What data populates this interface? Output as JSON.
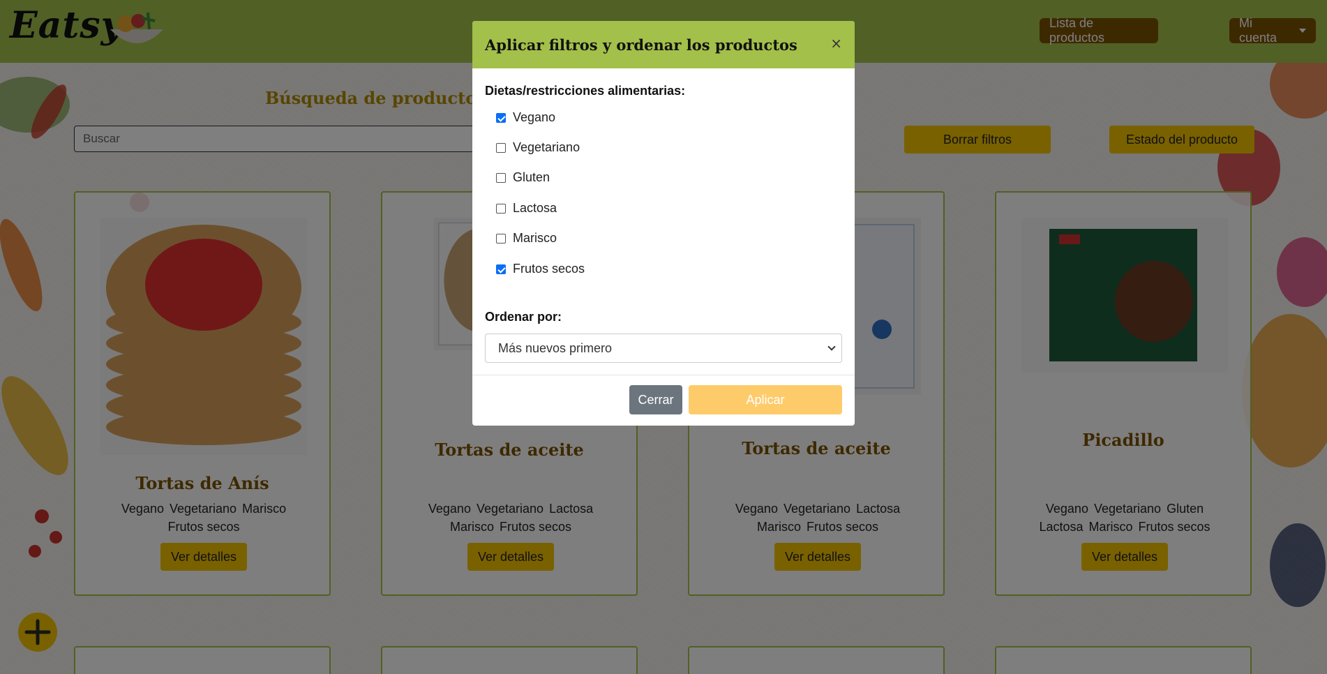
{
  "navbar": {
    "brand": "Eatsy",
    "product_list_label": "Lista de productos",
    "account_label": "Mi cuenta"
  },
  "search": {
    "title": "Búsqueda de productos",
    "placeholder": "Buscar"
  },
  "actions": {
    "clear_filters": "Borrar filtros",
    "product_state": "Estado del producto"
  },
  "cards": [
    {
      "title": "Tortas de Anís",
      "tags": [
        "Vegano",
        "Vegetariano",
        "Marisco",
        "Frutos secos"
      ],
      "button": "Ver detalles",
      "image": "tortas-de-anis-package"
    },
    {
      "title": "Tortas de aceite",
      "tags": [
        "Vegano",
        "Vegetariano",
        "Lactosa",
        "Marisco",
        "Frutos secos"
      ],
      "button": "Ver detalles",
      "image": "tortas-de-aceite-package"
    },
    {
      "title": "Tortas de aceite",
      "tags": [
        "Vegano",
        "Vegetariano",
        "Lactosa",
        "Marisco",
        "Frutos secos"
      ],
      "button": "Ver detalles",
      "image": "tortas-de-aceite-package"
    },
    {
      "title": "Picadillo",
      "tags": [
        "Vegano",
        "Vegetariano",
        "Gluten",
        "Lactosa",
        "Marisco",
        "Frutos secos"
      ],
      "button": "Ver detalles",
      "image": "green-cuisine-picadillo-box"
    }
  ],
  "modal": {
    "title": "Aplicar filtros y ordenar los productos",
    "close_symbol": "×",
    "diets_label": "Dietas/restricciones alimentarias:",
    "diets": [
      {
        "label": "Vegano",
        "checked": true
      },
      {
        "label": "Vegetariano",
        "checked": false
      },
      {
        "label": "Gluten",
        "checked": false
      },
      {
        "label": "Lactosa",
        "checked": false
      },
      {
        "label": "Marisco",
        "checked": false
      },
      {
        "label": "Frutos secos",
        "checked": true
      }
    ],
    "order_label": "Ordenar por:",
    "order_value": "Más nuevos primero",
    "close_button": "Cerrar",
    "apply_button": "Aplicar"
  },
  "colors": {
    "navbar": "#a3c04a",
    "nav_button": "#7a5200",
    "gold": "#f2c200",
    "checkbox": "#0b6ef5",
    "apply_disabled": "#fecb6b",
    "close_button": "#6c757d"
  },
  "icons": {
    "fab": "plus-icon",
    "modal_close": "close-icon",
    "select": "chevron-down-icon"
  }
}
